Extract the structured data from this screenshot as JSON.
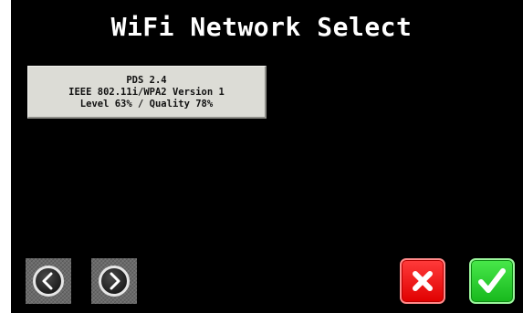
{
  "header": {
    "title": "WiFi Network Select"
  },
  "networks": [
    {
      "ssid": "PDS 2.4",
      "security": "IEEE 802.11i/WPA2 Version 1",
      "signal": "Level 63% / Quality 78%"
    }
  ],
  "controls": {
    "prev_icon": "chevron-left-icon",
    "next_icon": "chevron-right-icon",
    "cancel_icon": "x-icon",
    "confirm_icon": "checkmark-icon"
  },
  "colors": {
    "background": "#000000",
    "item_background": "#dcdcd6",
    "cancel_red": "#ee1111",
    "confirm_green": "#22cc22",
    "title_text": "#ffffff"
  }
}
